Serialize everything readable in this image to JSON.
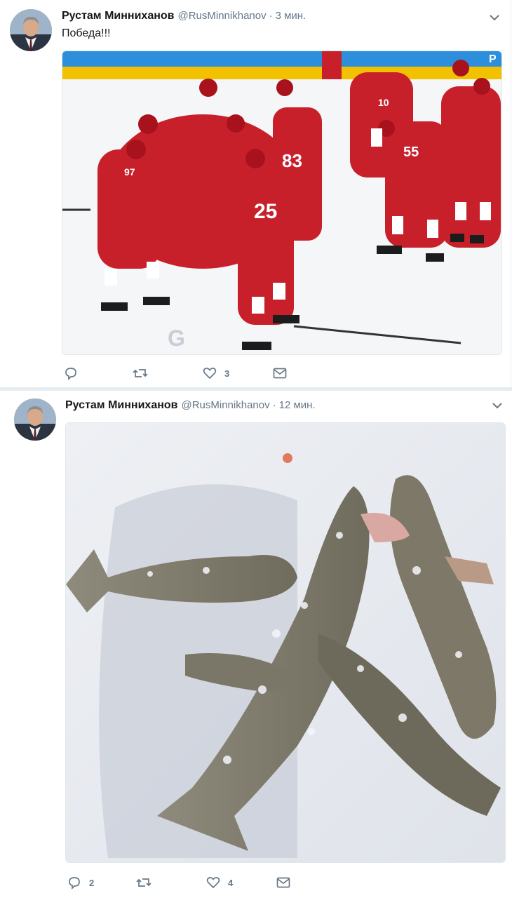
{
  "tweets": [
    {
      "author_name": "Рустам Минниханов",
      "handle": "@RusMinnikhanov",
      "separator": "·",
      "time": "3 мин.",
      "text": "Победа!!!",
      "media_icon": "hockey-team-celebration-photo",
      "replies": "",
      "retweets": "",
      "likes": "3"
    },
    {
      "author_name": "Рустам Минниханов",
      "handle": "@RusMinnikhanov",
      "separator": "·",
      "time": "12 мин.",
      "text": "",
      "media_icon": "frozen-fish-on-snow-photo",
      "replies": "2",
      "retweets": "",
      "likes": "4"
    }
  ],
  "colors": {
    "secondary_text": "#657786",
    "divider": "#e6ecf0",
    "jersey_red": "#c8202a"
  }
}
